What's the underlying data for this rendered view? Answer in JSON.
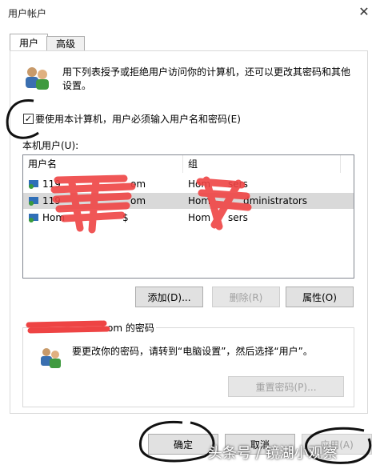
{
  "window": {
    "title": "用户帐户",
    "close_glyph": "✕"
  },
  "tabs": [
    {
      "label": "用户"
    },
    {
      "label": "高级"
    }
  ],
  "users_tab": {
    "description": "用下列表授予或拒绝用户访问你的计算机，还可以更改其密码和其他设置。",
    "require_login_label": "要使用本计算机，用户必须输入用户名和密码(E)",
    "require_login_checked": "✓",
    "list_label": "本机用户(U):",
    "columns": [
      "用户名",
      "组"
    ],
    "rows": [
      {
        "user": "119",
        "user_suffix": "om",
        "group": "Hom",
        "group_suffix": "sers"
      },
      {
        "user": "119",
        "user_suffix": "om",
        "group": "Hom",
        "group_suffix": "dministrators"
      },
      {
        "user": "Hom",
        "user_suffix": "$",
        "group": "Hom",
        "group_suffix": "sers"
      }
    ],
    "buttons": {
      "add": "添加(D)...",
      "remove": "删除(R)",
      "properties": "属性(O)"
    },
    "password_group_label_suffix": "om 的密码",
    "password_text": "要更改你的密码，请转到“电脑设置”，然后选择“用户”。",
    "reset_password": "重置密码(P)..."
  },
  "footer": {
    "ok": "确定",
    "cancel": "取消",
    "apply": "应用(A)"
  },
  "watermark": "头条号 / 镜湖小观察"
}
